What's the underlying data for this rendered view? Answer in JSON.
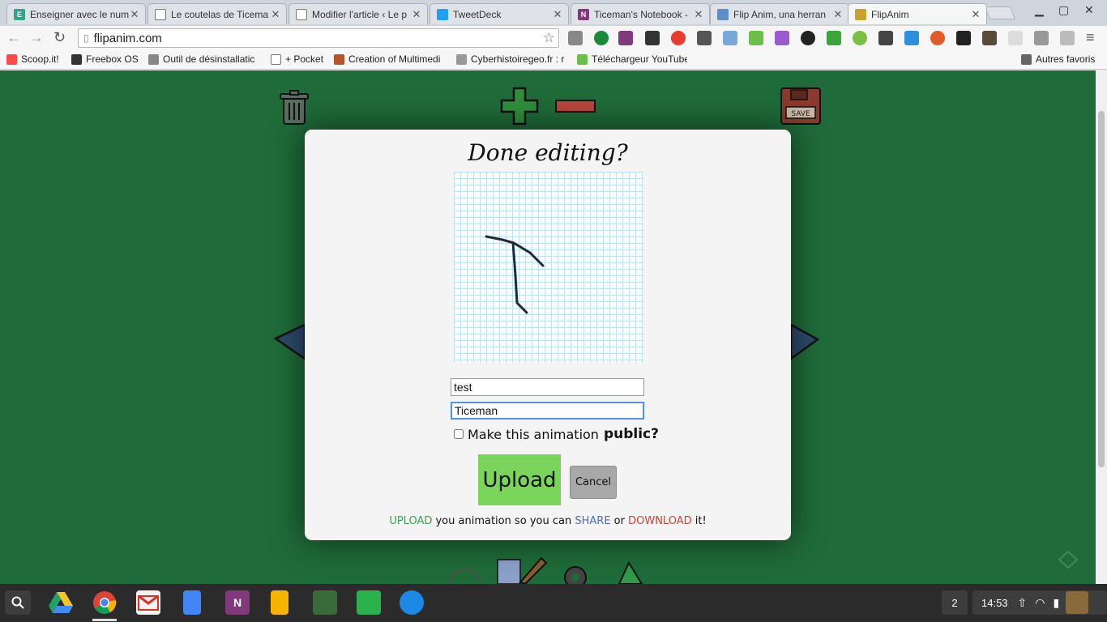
{
  "browser": {
    "tabs": [
      {
        "title": "Enseigner avec le num",
        "icon_color": "#2fa58e"
      },
      {
        "title": "Le coutelas de Ticema",
        "icon_color": "#ffffff"
      },
      {
        "title": "Modifier l'article ‹ Le p",
        "icon_color": "#ffffff"
      },
      {
        "title": "TweetDeck",
        "icon_color": "#1da1f2"
      },
      {
        "title": "Ticeman's Notebook -",
        "icon_color": "#80397b"
      },
      {
        "title": "Flip Anim, una herran",
        "icon_color": "#5b8fc9"
      },
      {
        "title": "FlipAnim",
        "icon_color": "#c9a227"
      }
    ],
    "close_glyph": "✕",
    "url": "flipanim.com"
  },
  "bookmarks": [
    {
      "label": "Scoop.it!",
      "color": "#ff4a4a"
    },
    {
      "label": "Freebox OS",
      "color": "#333333"
    },
    {
      "label": "Outil de désinstallatic",
      "color": "#888888"
    },
    {
      "label": "+ Pocket",
      "color": "#ffffff"
    },
    {
      "label": "Creation of Multimedi",
      "color": "#b4562d"
    },
    {
      "label": "Cyberhistoiregeo.fr : r",
      "color": "#999999"
    },
    {
      "label": "Téléchargeur YouTube",
      "color": "#6cc04a"
    },
    {
      "label": "Autres favoris",
      "color": "#666666"
    }
  ],
  "dialog": {
    "title": "Done editing?",
    "title_input_value": "test",
    "author_input_value": "Ticeman",
    "public_label": "Make this animation",
    "public_emphasis": "public?",
    "public_checked": false,
    "upload_label": "Upload",
    "cancel_label": "Cancel",
    "note_upload": "UPLOAD",
    "note_mid1": " you animation so you can ",
    "note_share": "SHARE",
    "note_mid2": " or ",
    "note_download": "DOWNLOAD",
    "note_end": " it!"
  },
  "colors": {
    "page_background": "#1f6b39",
    "upload_button": "#7ad55a",
    "cancel_button": "#a8a8a8"
  },
  "taskbar": {
    "notification_count": "2",
    "clock": "14:53"
  }
}
